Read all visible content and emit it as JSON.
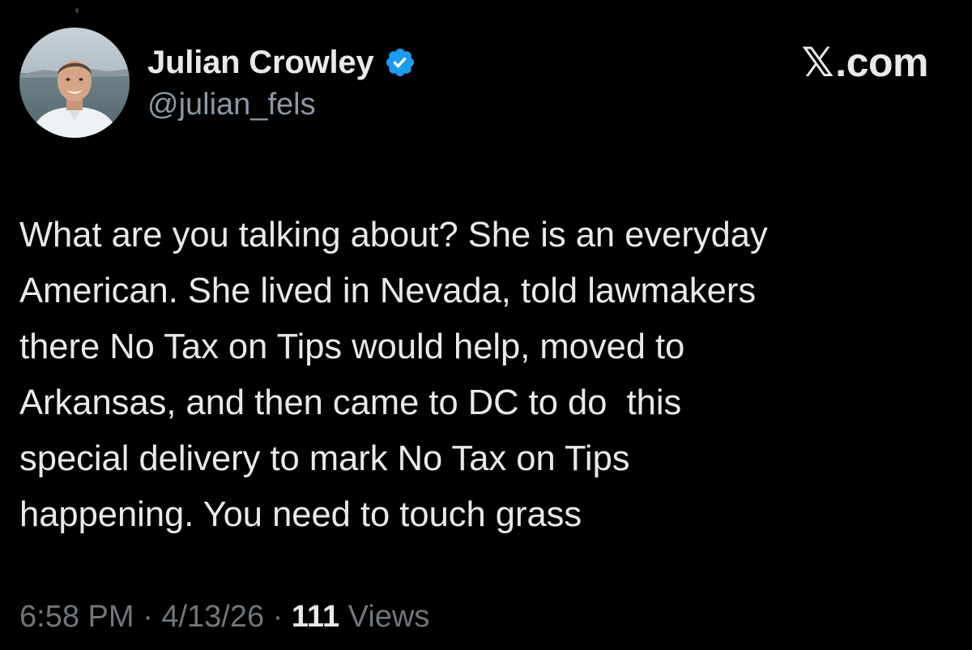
{
  "author": {
    "name": "Julian Crowley",
    "handle": "@julian_fels",
    "verified": true,
    "avatar": "profile-photo"
  },
  "brand": {
    "x_glyph": "𝕏",
    "domain": ".com"
  },
  "tweet": {
    "lines": [
      "What are you talking about? She is an everyday",
      "American. She lived in Nevada, told lawmakers",
      "there No Tax on Tips would help, moved to",
      "Arkansas, and then came to DC to do  this",
      "special delivery to mark No Tax on Tips",
      "happening. You need to touch grass"
    ]
  },
  "meta": {
    "time": "6:58 PM",
    "separator": " · ",
    "date": "4/13/26",
    "views_count": "111",
    "views_label": " Views"
  },
  "colors": {
    "background": "#000000",
    "primary_text": "#e7e9ea",
    "secondary_text": "#71767b",
    "verified_badge": "#1d9bf0"
  }
}
